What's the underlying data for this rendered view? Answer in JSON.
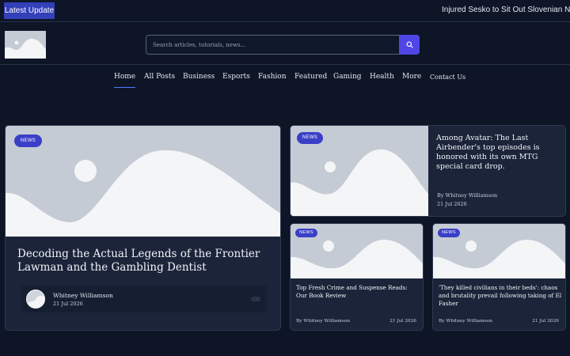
{
  "ticker": {
    "label": "Latest  Update",
    "headline": "Injured Sesko to Sit Out Slovenian Nations League Matches"
  },
  "header": {
    "logo_icon": "image-placeholder-icon",
    "search": {
      "placeholder": "Search articles, tutorials, news...",
      "value": ""
    },
    "search_button_icon": "search-icon"
  },
  "nav": {
    "items": [
      {
        "label": "Home",
        "active": true
      },
      {
        "label": "All Posts"
      },
      {
        "label": "Business"
      },
      {
        "label": "Esports"
      },
      {
        "label": "Fashion"
      },
      {
        "label": "Featured"
      },
      {
        "label": "Gaming"
      },
      {
        "label": "Health"
      },
      {
        "label": "More"
      },
      {
        "label": "Contact Us"
      }
    ]
  },
  "featured": {
    "badge": "NEWS",
    "title": "Decoding the Actual Legends of the Frontier Lawman and the Gambling Dentist",
    "author": "Whitney Williamson",
    "date": "21 Jul 2026"
  },
  "side_card": {
    "badge": "NEWS",
    "title": "Among Avatar: The Last Airbender's top episodes is honored with its own MTG special card drop.",
    "author": "By Whitney Williamson",
    "date": "21 Jul 2026"
  },
  "small_cards": [
    {
      "badge": "NEWS",
      "title": "Top Fresh Crime and Suspense Reads: Our Book Review",
      "author": "By Whitney Williamson",
      "date": "21 Jul 2026"
    },
    {
      "badge": "NEWS",
      "title": "'They killed civilians in their beds': chaos and brutality prevail following taking of El Fasher",
      "author": "By Whitney Williamson",
      "date": "21 Jul 2026"
    }
  ],
  "colors": {
    "background": "#0d1527",
    "card": "#1b2439",
    "accent": "#4f46e5",
    "badge": "#3a3fc8",
    "ticker_label": "#3340b8"
  }
}
